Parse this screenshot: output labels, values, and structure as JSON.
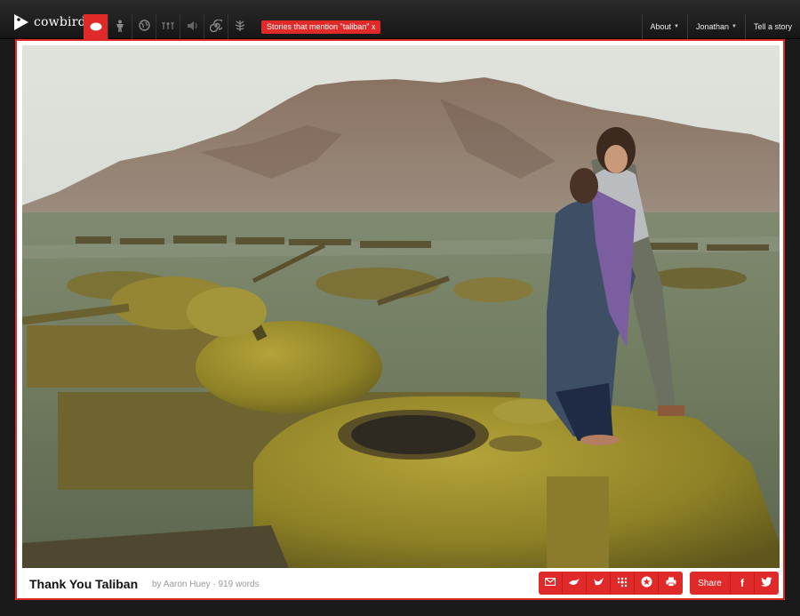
{
  "header": {
    "brand": "cowbird",
    "filter_tag": "Stories that mention \"taliban\" x",
    "right_nav": [
      {
        "label": "About",
        "has_dropdown": true
      },
      {
        "label": "Jonathan",
        "has_dropdown": true
      },
      {
        "label": "Tell a story",
        "has_dropdown": false
      }
    ],
    "nav_icons": [
      "stories-icon",
      "people-icon",
      "places-icon",
      "seeds-icon",
      "sound-icon",
      "spiral-icon",
      "tree-icon"
    ]
  },
  "story": {
    "title": "Thank You Taliban",
    "byline": "by Aaron Huey · 919 words"
  },
  "share": {
    "label": "Share",
    "facebook_glyph": "f"
  },
  "colors": {
    "accent": "#e02a2a",
    "topbar": "#1e1e1e"
  }
}
